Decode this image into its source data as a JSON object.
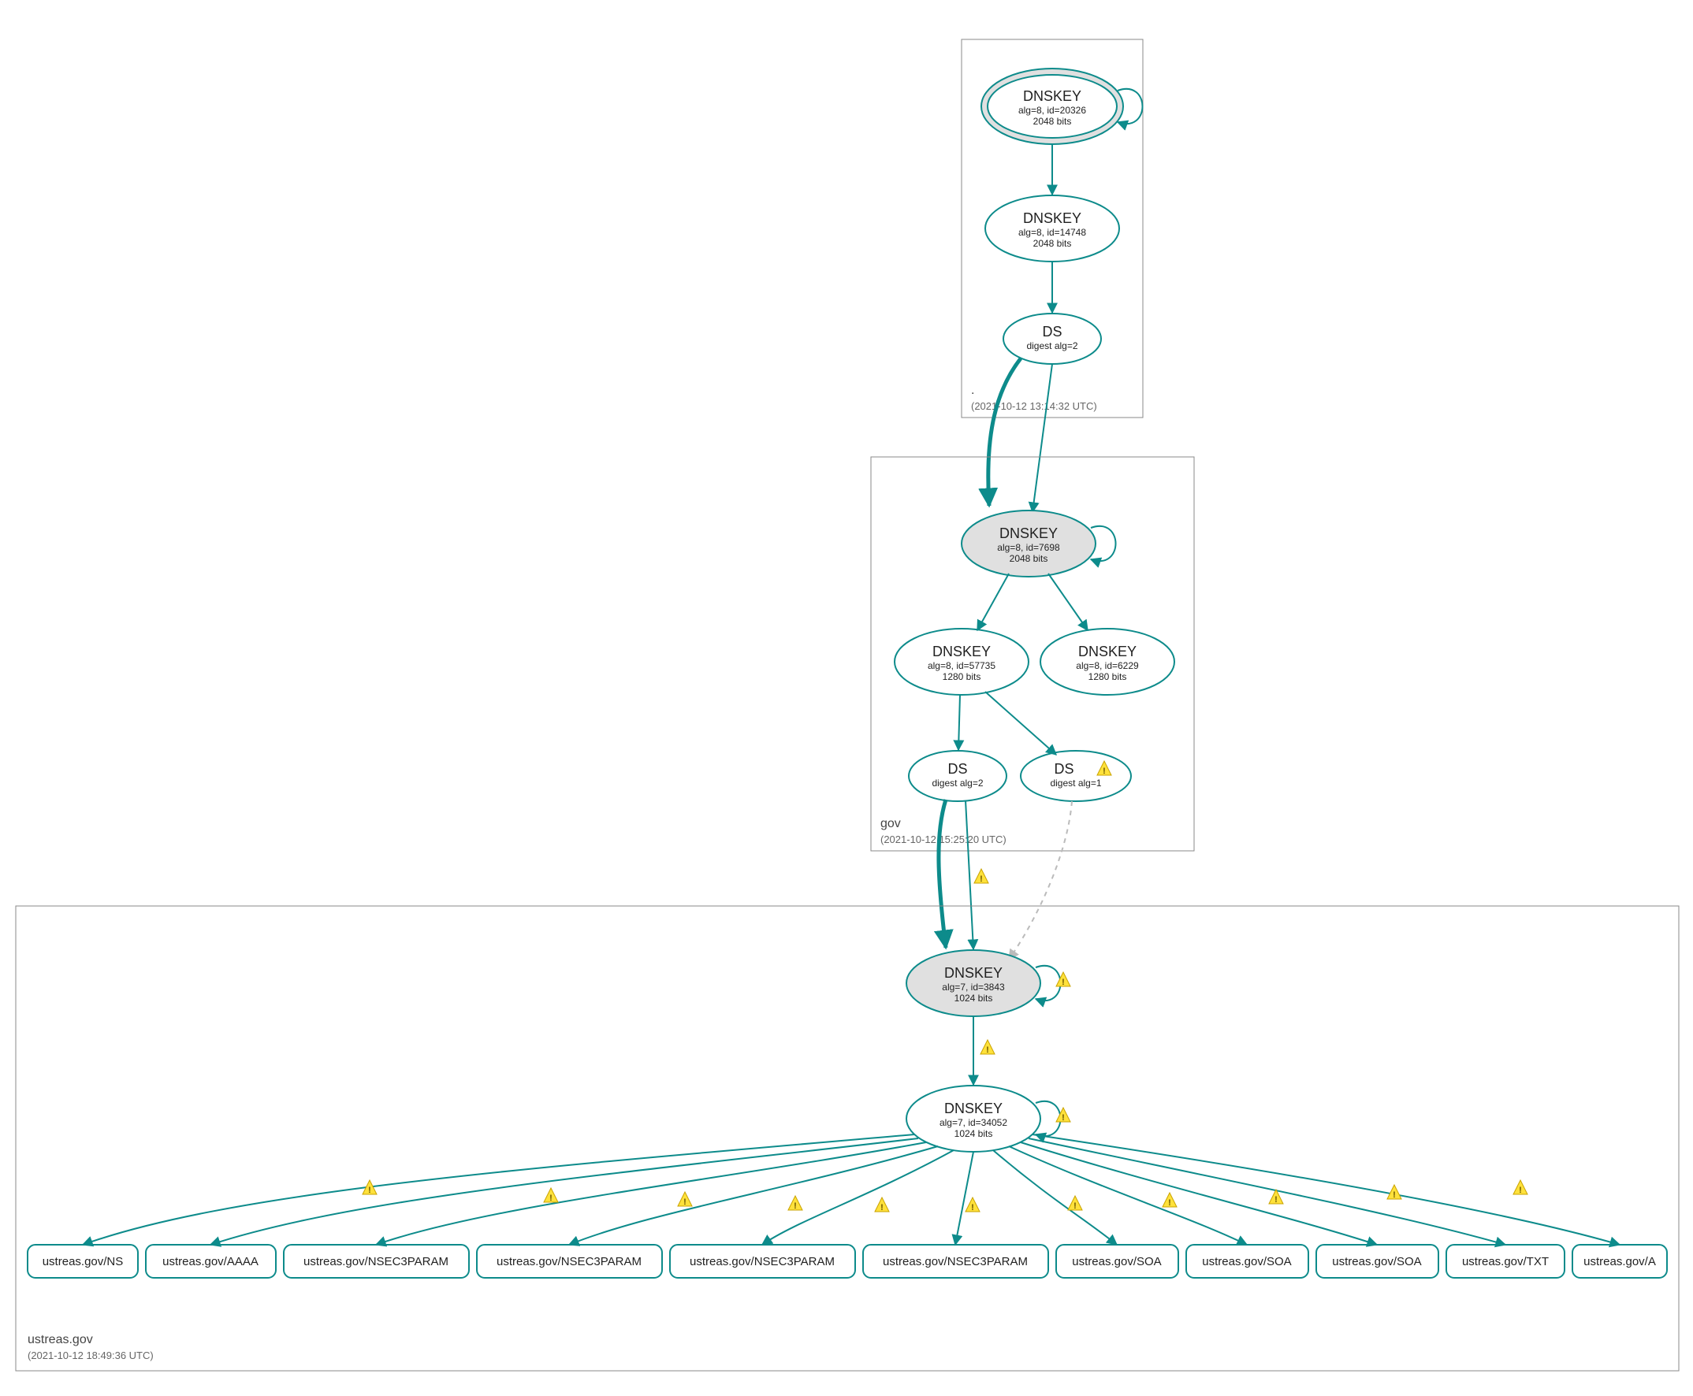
{
  "zones": {
    "root": {
      "label": ".",
      "timestamp": "(2021-10-12 13:14:32 UTC)"
    },
    "gov": {
      "label": "gov",
      "timestamp": "(2021-10-12 15:25:20 UTC)"
    },
    "ustreas": {
      "label": "ustreas.gov",
      "timestamp": "(2021-10-12 18:49:36 UTC)"
    }
  },
  "nodes": {
    "root_ksk": {
      "title": "DNSKEY",
      "line2": "alg=8, id=20326",
      "line3": "2048 bits"
    },
    "root_zsk": {
      "title": "DNSKEY",
      "line2": "alg=8, id=14748",
      "line3": "2048 bits"
    },
    "root_ds": {
      "title": "DS",
      "line2": "digest alg=2",
      "line3": ""
    },
    "gov_ksk": {
      "title": "DNSKEY",
      "line2": "alg=8, id=7698",
      "line3": "2048 bits"
    },
    "gov_zsk1": {
      "title": "DNSKEY",
      "line2": "alg=8, id=57735",
      "line3": "1280 bits"
    },
    "gov_zsk2": {
      "title": "DNSKEY",
      "line2": "alg=8, id=6229",
      "line3": "1280 bits"
    },
    "gov_ds1": {
      "title": "DS",
      "line2": "digest alg=2",
      "line3": ""
    },
    "gov_ds2": {
      "title": "DS",
      "line2": "digest alg=1",
      "line3": ""
    },
    "ust_ksk": {
      "title": "DNSKEY",
      "line2": "alg=7, id=3843",
      "line3": "1024 bits"
    },
    "ust_zsk": {
      "title": "DNSKEY",
      "line2": "alg=7, id=34052",
      "line3": "1024 bits"
    }
  },
  "rrsets": [
    "ustreas.gov/NS",
    "ustreas.gov/AAAA",
    "ustreas.gov/NSEC3PARAM",
    "ustreas.gov/NSEC3PARAM",
    "ustreas.gov/NSEC3PARAM",
    "ustreas.gov/NSEC3PARAM",
    "ustreas.gov/SOA",
    "ustreas.gov/SOA",
    "ustreas.gov/SOA",
    "ustreas.gov/TXT",
    "ustreas.gov/A"
  ]
}
